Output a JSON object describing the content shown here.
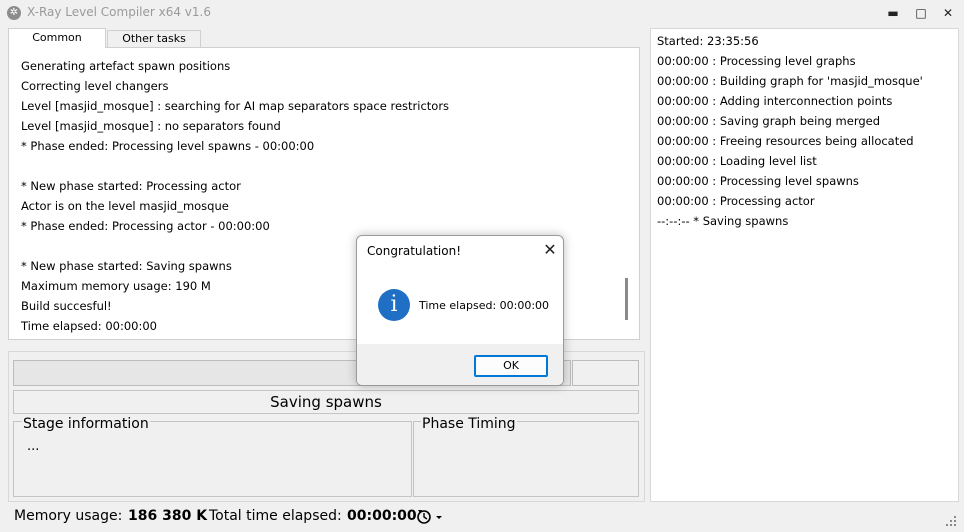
{
  "window": {
    "title": "X-Ray Level Compiler x64 v1.6",
    "minimize_glyph": "▬",
    "maximize_glyph": "□",
    "close_glyph": "✕"
  },
  "tabs": [
    {
      "label": "Common",
      "active": true
    },
    {
      "label": "Other tasks",
      "active": false
    }
  ],
  "log": {
    "lines": [
      "Generating artefact spawn positions",
      "Correcting level changers",
      "Level [masjid_mosque] : searching for AI map separators space restrictors",
      "Level [masjid_mosque] : no separators found",
      "* Phase ended: Processing level spawns - 00:00:00",
      "",
      "* New phase started: Processing actor",
      "Actor is on the level masjid_mosque",
      "* Phase ended: Processing actor - 00:00:00",
      "",
      "* New phase started: Saving spawns",
      "Maximum memory usage: 190 M",
      "Build succesful!",
      "Time elapsed: 00:00:00"
    ]
  },
  "progress": {
    "value": 1.0
  },
  "phase": {
    "name": "Saving spawns"
  },
  "stage": {
    "title": "Stage information",
    "text": "..."
  },
  "timing": {
    "title": "Phase Timing"
  },
  "side_log": {
    "lines": [
      "Started: 23:35:56",
      "00:00:00 : Processing level graphs",
      "00:00:00 : Building graph for 'masjid_mosque'",
      "00:00:00 : Adding interconnection points",
      "00:00:00 : Saving graph being merged",
      "00:00:00 : Freeing resources being allocated",
      "00:00:00 : Loading level list",
      "00:00:00 : Processing level spawns",
      "00:00:00 : Processing actor",
      "--:--:-- * Saving spawns"
    ]
  },
  "status": {
    "memory_label": "Memory usage:",
    "memory_value": "186 380 K",
    "time_label": "Total time elapsed:",
    "time_value": "00:00:00"
  },
  "dialog": {
    "title": "Congratulation!",
    "message": "Time elapsed: 00:00:00",
    "ok_label": "OK",
    "close_glyph": "✕",
    "icon_glyph": "i"
  },
  "colors": {
    "info_icon": "#1f6fc5",
    "ok_border": "#0078d7",
    "background": "#f0f0f0"
  }
}
